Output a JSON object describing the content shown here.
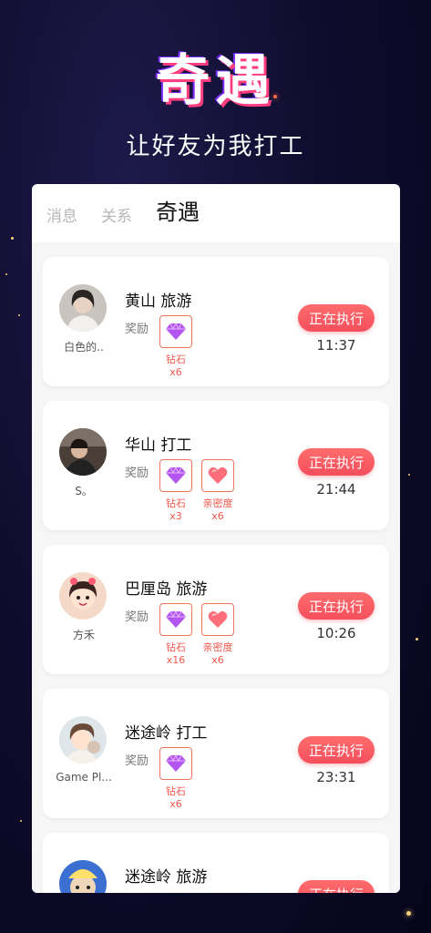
{
  "hero": {
    "title": "奇遇",
    "subtitle": "让好友为我打工"
  },
  "tabs": [
    {
      "label": "消息",
      "active": false
    },
    {
      "label": "关系",
      "active": false
    },
    {
      "label": "奇遇",
      "active": true
    }
  ],
  "colors": {
    "accent": "#f44f5d",
    "reward_border": "#f0735c",
    "reward_text": "#f0564a"
  },
  "tasks": [
    {
      "user": "白色的..",
      "destination": "黄山  旅游",
      "reward_label": "奖励",
      "rewards": [
        {
          "name": "钻石",
          "count": "x6",
          "icon": "diamond-icon"
        }
      ],
      "status": "正在执行",
      "time": "11:37"
    },
    {
      "user": "S。",
      "destination": "华山  打工",
      "reward_label": "奖励",
      "rewards": [
        {
          "name": "钻石",
          "count": "x3",
          "icon": "diamond-icon"
        },
        {
          "name": "亲密度",
          "count": "x6",
          "icon": "heart-icon"
        }
      ],
      "status": "正在执行",
      "time": "21:44"
    },
    {
      "user": "方禾",
      "destination": "巴厘岛  旅游",
      "reward_label": "奖励",
      "rewards": [
        {
          "name": "钻石",
          "count": "x16",
          "icon": "diamond-icon"
        },
        {
          "name": "亲密度",
          "count": "x6",
          "icon": "heart-icon"
        }
      ],
      "status": "正在执行",
      "time": "10:26"
    },
    {
      "user": "Game Pl...",
      "destination": "迷途岭  打工",
      "reward_label": "奖励",
      "rewards": [
        {
          "name": "钻石",
          "count": "x6",
          "icon": "diamond-icon"
        }
      ],
      "status": "正在执行",
      "time": "23:31"
    },
    {
      "user": "",
      "destination": "迷途岭  旅游",
      "reward_label": "",
      "rewards": [],
      "status": "正在执行",
      "time": ""
    }
  ]
}
